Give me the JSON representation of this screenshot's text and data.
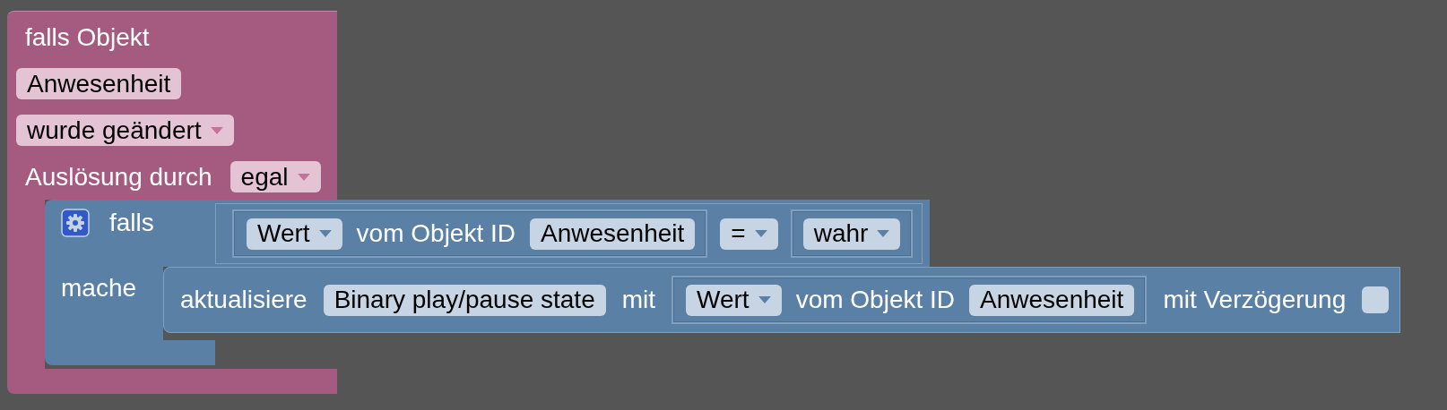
{
  "trigger_block": {
    "title": "falls Objekt",
    "object": "Anwesenheit",
    "condition": {
      "value": "wurde geändert"
    },
    "trigger_label": "Auslösung durch",
    "trigger": {
      "value": "egal"
    }
  },
  "if_block": {
    "label": "falls",
    "do_label": "mache",
    "condition": {
      "property": {
        "value": "Wert"
      },
      "text": "vom Objekt ID",
      "object": "Anwesenheit",
      "operator": {
        "value": "="
      },
      "compare_value": {
        "value": "wahr"
      }
    },
    "statement": {
      "label": "aktualisiere",
      "target": "Binary play/pause state",
      "with_label": "mit",
      "value": {
        "property": {
          "value": "Wert"
        },
        "text": "vom Objekt ID",
        "object": "Anwesenheit"
      },
      "delay_label": "mit Verzögerung",
      "delay": {
        "checked": false
      }
    }
  }
}
